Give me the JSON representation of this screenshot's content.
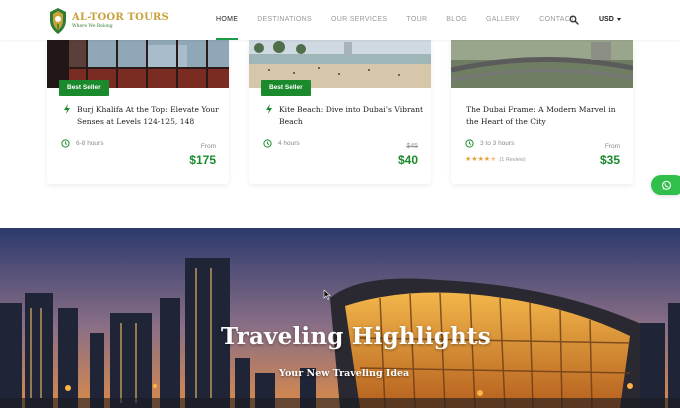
{
  "brand": {
    "name": "AL-TOOR TOURS",
    "tagline": "Where We Belong"
  },
  "nav": {
    "items": [
      {
        "label": "HOME",
        "active": true
      },
      {
        "label": "DESTINATIONS",
        "active": false
      },
      {
        "label": "OUR SERVICES",
        "active": false
      },
      {
        "label": "TOUR",
        "active": false
      },
      {
        "label": "BLOG",
        "active": false
      },
      {
        "label": "GALLERY",
        "active": false
      },
      {
        "label": "CONTACT",
        "active": false
      }
    ],
    "search_icon": "search-icon",
    "currency": "USD"
  },
  "cards": [
    {
      "badge": "Best Seller",
      "title": "Burj Khalifa At the Top: Elevate Your Senses at Levels 124-125, 148",
      "duration": "6-8 hours",
      "price_label": "From",
      "price": "$175"
    },
    {
      "badge": "Best Seller",
      "title": "Kite Beach: Dive into Dubai’s Vibrant Beach",
      "duration": "4 hours",
      "old_price": "$45",
      "price": "$40"
    },
    {
      "title": "The Dubai Frame: A Modern Marvel in the Heart of the City",
      "duration": "3 to 3 hours",
      "rating": 4.5,
      "reviews": "(1 Review)",
      "price_label": "From",
      "price": "$35"
    }
  ],
  "hero": {
    "title": "Traveling Highlights",
    "subtitle": "Your New Traveling Idea"
  },
  "colors": {
    "accent": "#1a8a2d",
    "nav_underline": "#1c9c48",
    "whatsapp": "#2fbf4a",
    "star": "#e6a23c"
  }
}
